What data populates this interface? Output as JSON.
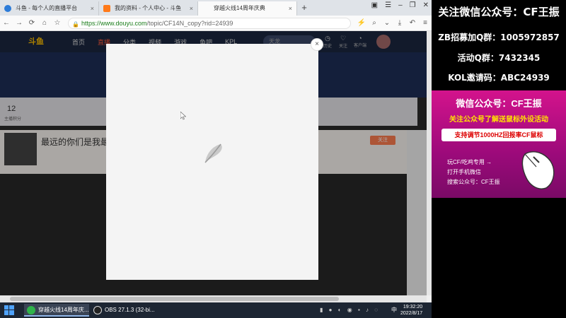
{
  "browser": {
    "tabs": [
      {
        "title": "斗鱼 - 每个人的直播平台"
      },
      {
        "title": "我的资料 - 个人中心 - 斗鱼"
      },
      {
        "title": "穿越火线14周年庆典"
      }
    ],
    "new_tab_symbol": "+",
    "url_host": "https://www.douyu.com",
    "url_path": "/topic/CF14N_copy?rid=24939"
  },
  "site": {
    "logo": "斗鱼",
    "nav": [
      "首页",
      "直播",
      "分类",
      "视频",
      "游戏",
      "鱼吧",
      "KPL"
    ],
    "search_placeholder": "天龙",
    "header_icons": [
      {
        "icon": "clock-icon",
        "label": "历史"
      },
      {
        "icon": "heart-icon",
        "label": "关注"
      },
      {
        "icon": "bell-icon",
        "label": "客户端"
      }
    ],
    "stat_number": "12",
    "stat_label": "主播积分",
    "room_title": "最远的你们是我最近的",
    "follow_label": "关注"
  },
  "modal": {
    "close_symbol": "×"
  },
  "taskbar": {
    "apps": [
      {
        "label": "穿越火线14周年庆..."
      },
      {
        "label": "OBS 27.1.3 (32-bi..."
      }
    ],
    "lang": "中",
    "time": "19:32:20",
    "date": "2022/8/17"
  },
  "ad": {
    "line1": "关注微信公众号：CF王振",
    "line2": "ZB招募加Q群：1005972857",
    "line3": "活动Q群：7432345",
    "line4": "KOL邀请码：ABC24939",
    "promo_title": "微信公众号：CF王振",
    "promo_sub": "关注公众号了解送鼠标外设活动",
    "promo_highlight": "支持调节1000HZ回报率CF鼠标",
    "promo_info": [
      "玩CF/吃鸡专用 →",
      "打开手机微信",
      "搜索公众号：CF王振"
    ]
  },
  "colors": {
    "accent": "#ff5a3c",
    "ad_magenta": "#d3138c",
    "ad_yellow": "#ffe400"
  }
}
